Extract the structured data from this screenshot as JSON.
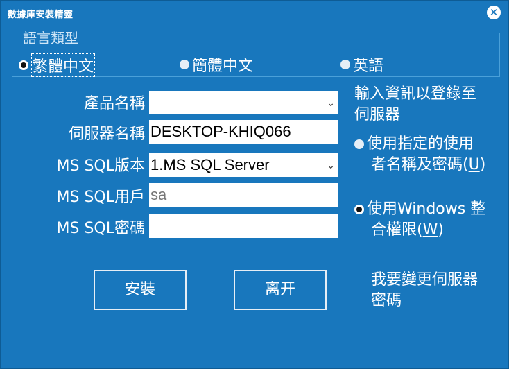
{
  "window": {
    "title": "數據庫安裝精靈"
  },
  "language": {
    "legend": "語言類型",
    "options": [
      "繁體中文",
      "簡體中文",
      "英語"
    ],
    "selected": "繁體中文"
  },
  "form": {
    "product_label": "產品名稱",
    "product_value": "",
    "server_label": "伺服器名稱",
    "server_value": "DESKTOP-KHIQ066",
    "version_label": "MS SQL版本",
    "version_value": "1.MS SQL Server",
    "user_label": "MS SQL用戶",
    "user_value": "sa",
    "password_label": "MS SQL密碼",
    "password_value": ""
  },
  "auth": {
    "info": [
      "輸入資訊以登錄至",
      "伺服器"
    ],
    "opt1": [
      "使用指定的使用",
      "者名稱及密碼(",
      "U",
      ")"
    ],
    "opt2": [
      "使用Windows 整",
      "合權限(",
      "W",
      ")"
    ],
    "selected": "opt2"
  },
  "actions": {
    "install": "安裝",
    "exit": "离开",
    "change_password": [
      "我要變更伺服器",
      "密碼"
    ]
  }
}
